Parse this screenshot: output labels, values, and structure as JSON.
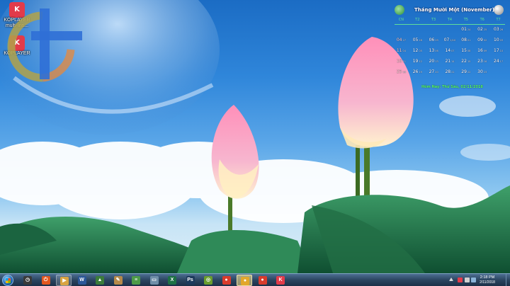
{
  "desktop": {
    "icons": [
      {
        "name": "KOPLAYER",
        "sub": "multi-Ins..."
      },
      {
        "name": "KOPLAYER",
        "sub": ""
      }
    ]
  },
  "calendar": {
    "title": "Tháng Mười Một (November)",
    "weekdays": [
      "CN",
      "T2",
      "T3",
      "T4",
      "T5",
      "T6",
      "T7"
    ],
    "weeks": [
      [
        {
          "d": ""
        },
        {
          "d": ""
        },
        {
          "d": ""
        },
        {
          "d": ""
        },
        {
          "d": "01",
          "s": "24"
        },
        {
          "d": "02",
          "s": "25",
          "today": false
        },
        {
          "d": "03",
          "s": "26"
        }
      ],
      [
        {
          "d": "04",
          "s": "27"
        },
        {
          "d": "05",
          "s": "28"
        },
        {
          "d": "06",
          "s": "29"
        },
        {
          "d": "07",
          "s": "1/10"
        },
        {
          "d": "08",
          "s": "01"
        },
        {
          "d": "09",
          "s": "02"
        },
        {
          "d": "10",
          "s": "03"
        }
      ],
      [
        {
          "d": "11",
          "s": "04"
        },
        {
          "d": "12",
          "s": "05"
        },
        {
          "d": "13",
          "s": "06"
        },
        {
          "d": "14",
          "s": "07"
        },
        {
          "d": "15",
          "s": "08"
        },
        {
          "d": "16",
          "s": "09"
        },
        {
          "d": "17",
          "s": "10"
        }
      ],
      [
        {
          "d": "18",
          "s": "11"
        },
        {
          "d": "19",
          "s": "12"
        },
        {
          "d": "20",
          "s": "13"
        },
        {
          "d": "21",
          "s": "14"
        },
        {
          "d": "22",
          "s": "15"
        },
        {
          "d": "23",
          "s": "16"
        },
        {
          "d": "24",
          "s": "17"
        }
      ],
      [
        {
          "d": "25",
          "s": "18"
        },
        {
          "d": "26",
          "s": "19"
        },
        {
          "d": "27",
          "s": "20"
        },
        {
          "d": "28",
          "s": "21"
        },
        {
          "d": "29",
          "s": "22"
        },
        {
          "d": "30",
          "s": "23"
        },
        {
          "d": ""
        }
      ]
    ],
    "footer": "Hôm Nay: Thứ Sáu, 02/11/2018"
  },
  "taskbar": {
    "items": [
      {
        "name": "taskbar-timer-app",
        "color": "#3a3a3a",
        "glyph": "◷",
        "state": ""
      },
      {
        "name": "taskbar-power-app",
        "color": "#e2571e",
        "glyph": "⏻",
        "state": ""
      },
      {
        "name": "taskbar-media-app",
        "color": "#d9a441",
        "glyph": "▶",
        "state": "active"
      },
      {
        "name": "taskbar-word-app",
        "color": "#2b5797",
        "glyph": "W",
        "state": ""
      },
      {
        "name": "taskbar-chart-app",
        "color": "#3b7c3b",
        "glyph": "▲",
        "state": ""
      },
      {
        "name": "taskbar-tools-app",
        "color": "#b68a4a",
        "glyph": "✎",
        "state": ""
      },
      {
        "name": "taskbar-notepad-app",
        "color": "#4d9b48",
        "glyph": "≡",
        "state": ""
      },
      {
        "name": "taskbar-window-app",
        "color": "#6f8ea8",
        "glyph": "▭",
        "state": ""
      },
      {
        "name": "taskbar-excel-app",
        "color": "#1e7145",
        "glyph": "X",
        "state": ""
      },
      {
        "name": "taskbar-photoshop-app",
        "color": "#1d3a5c",
        "glyph": "Ps",
        "state": ""
      },
      {
        "name": "taskbar-target-app",
        "color": "#6a9d2d",
        "glyph": "◎",
        "state": ""
      },
      {
        "name": "taskbar-chrome-app",
        "color": "#d93b2b",
        "glyph": "●",
        "state": ""
      },
      {
        "name": "taskbar-chrome-profile-app",
        "color": "#e2a72b",
        "glyph": "●",
        "state": "highlight"
      },
      {
        "name": "taskbar-chrome-app-2",
        "color": "#d93b2b",
        "glyph": "●",
        "state": ""
      },
      {
        "name": "taskbar-koplayer-app",
        "color": "#e23b4a",
        "glyph": "K",
        "state": ""
      }
    ],
    "clock": {
      "time": "2:18 PM",
      "date": "2/11/2018"
    }
  }
}
